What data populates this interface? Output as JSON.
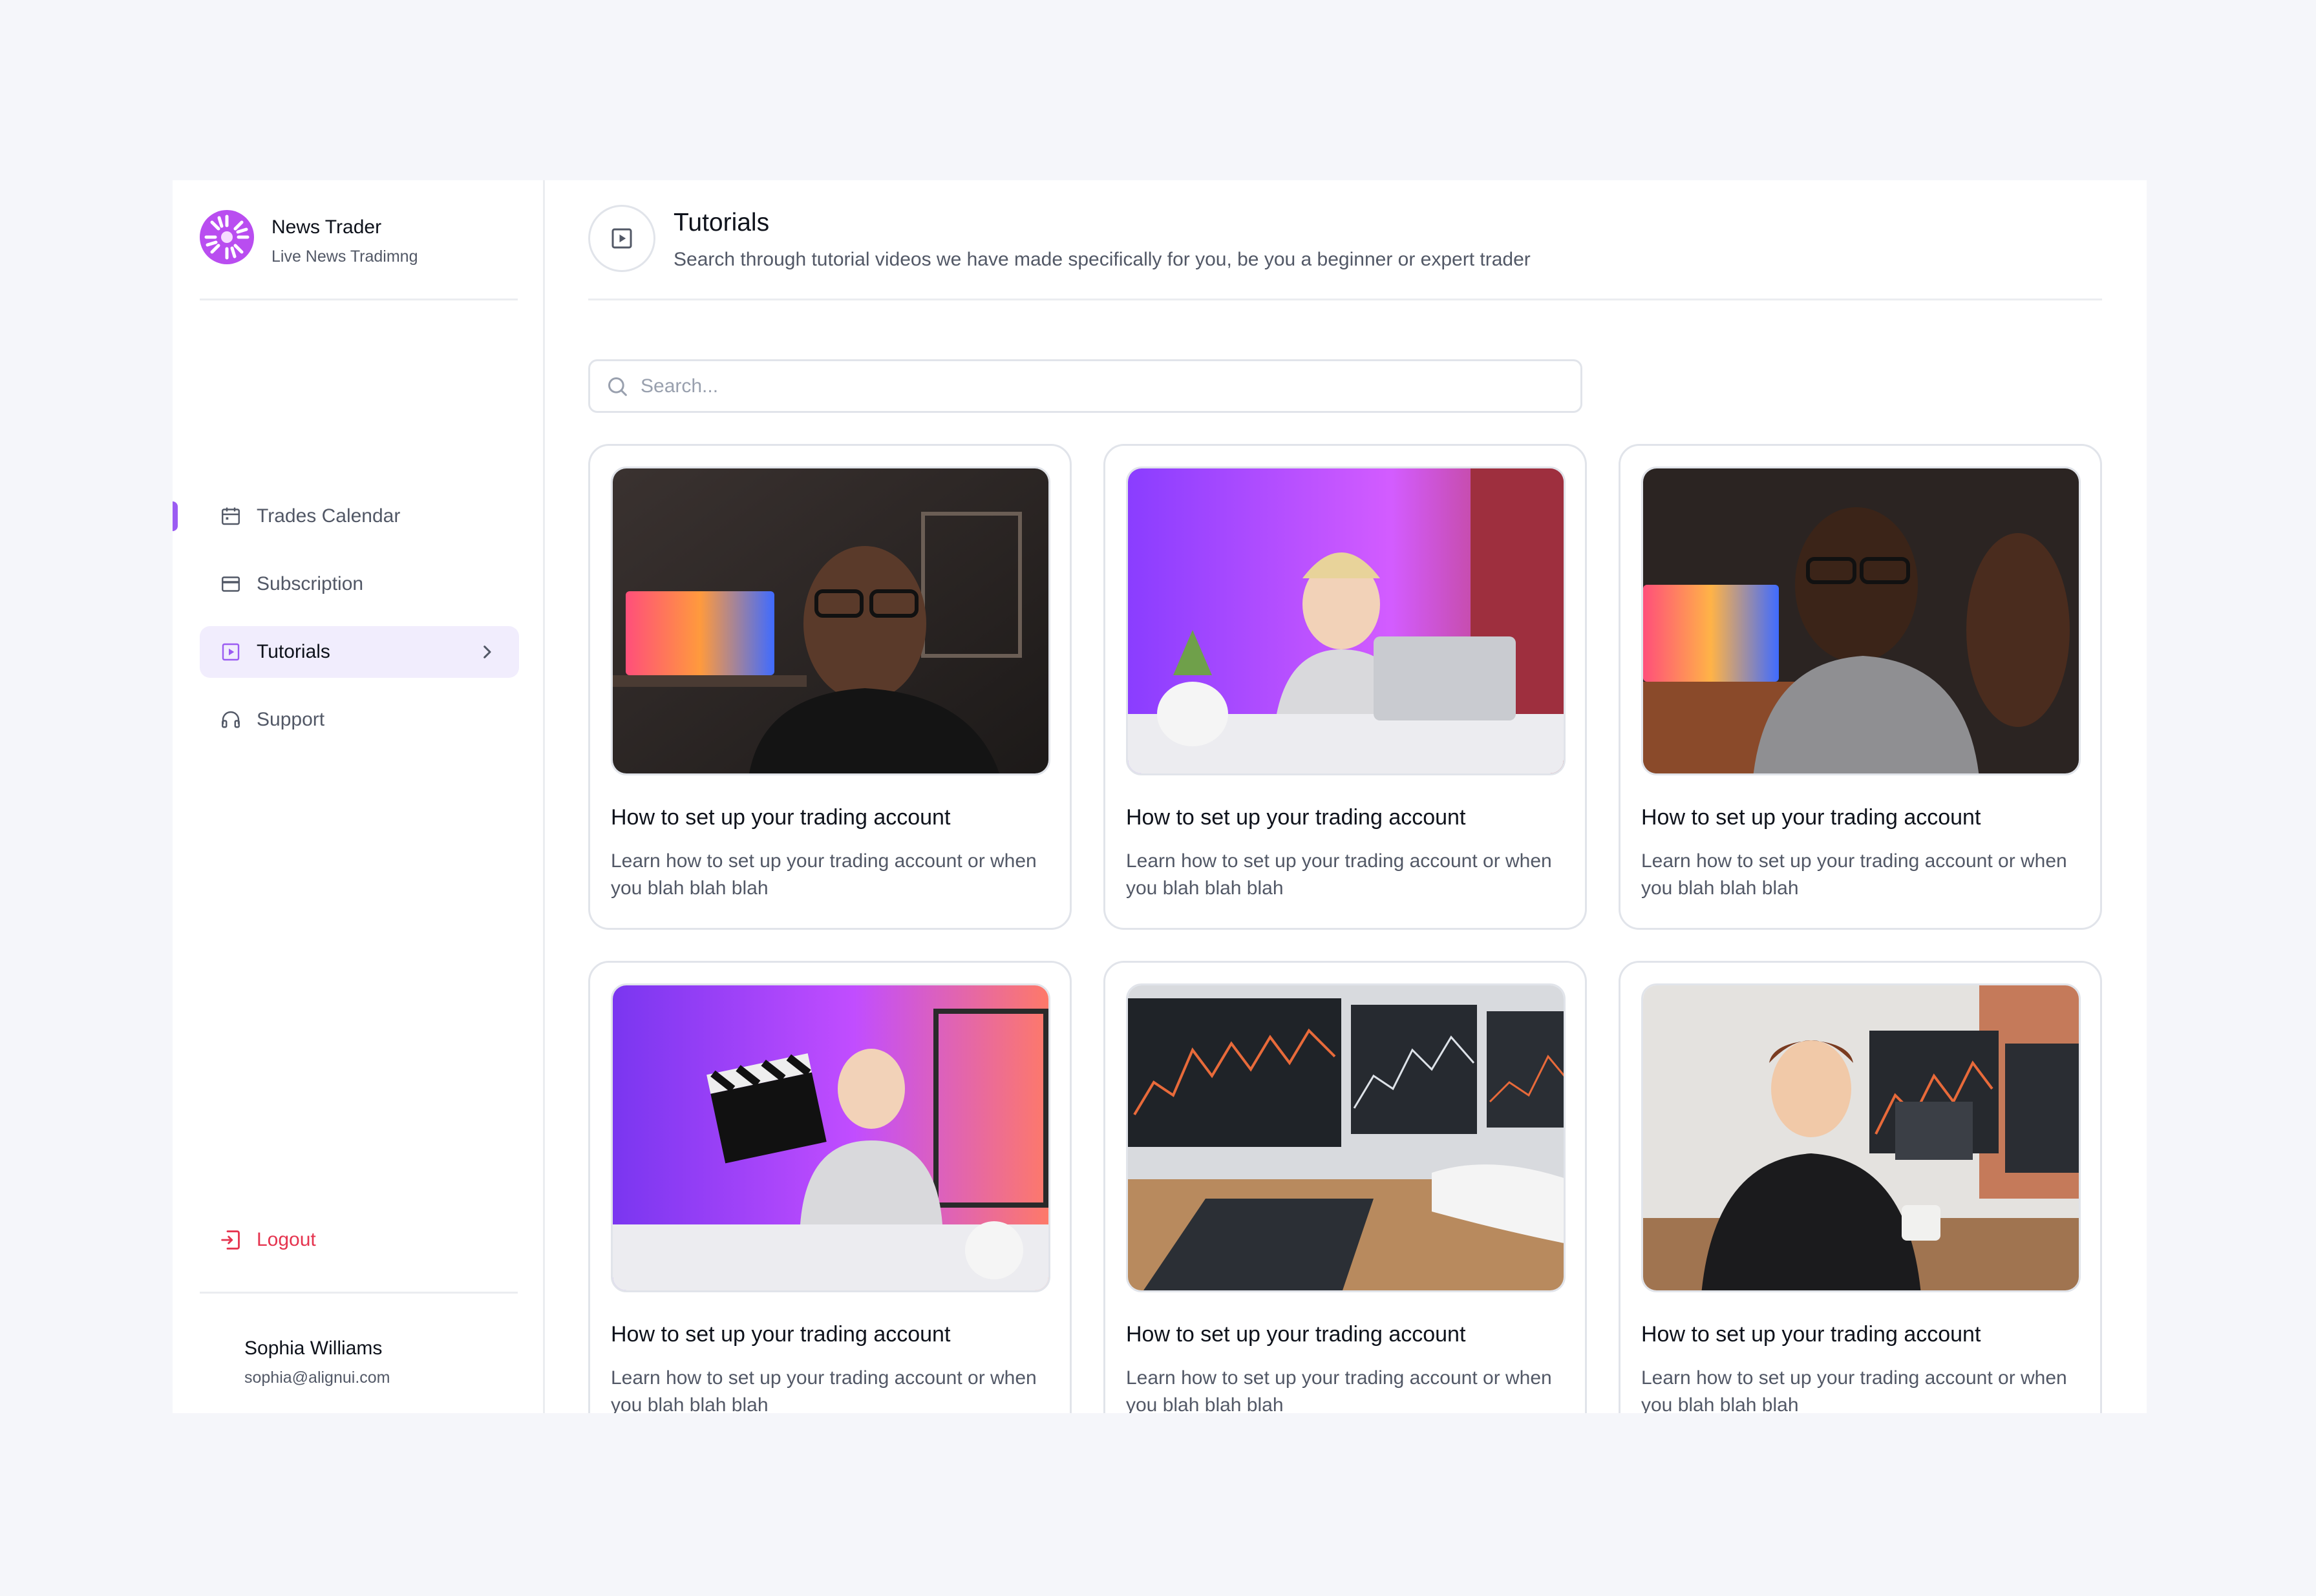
{
  "brand": {
    "name": "News Trader",
    "subtitle": "Live News Tradimng"
  },
  "nav": {
    "items": [
      {
        "label": "Trades Calendar",
        "icon": "calendar-icon",
        "active": false
      },
      {
        "label": "Subscription",
        "icon": "credit-card-icon",
        "active": false
      },
      {
        "label": "Tutorials",
        "icon": "play-square-icon",
        "active": true
      },
      {
        "label": "Support",
        "icon": "headphones-icon",
        "active": false
      }
    ],
    "logout_label": "Logout"
  },
  "user": {
    "name": "Sophia Williams",
    "email": "sophia@alignui.com"
  },
  "header": {
    "title": "Tutorials",
    "description": "Search through tutorial videos we have made specifically for you, be you a beginner or expert trader"
  },
  "search": {
    "placeholder": "Search...",
    "value": ""
  },
  "cards": [
    {
      "title": "How to set up your trading account",
      "description": "Learn how to set up your trading account or when you blah blah blah"
    },
    {
      "title": "How to set up your trading account",
      "description": "Learn how to set up your trading account or when you blah blah blah"
    },
    {
      "title": "How to set up your trading account",
      "description": "Learn how to set up your trading account or when you blah blah blah"
    },
    {
      "title": "How to set up your trading account",
      "description": "Learn how to set up your trading account or when you blah blah blah"
    },
    {
      "title": "How to set up your trading account",
      "description": "Learn how to set up your trading account or when you blah blah blah"
    },
    {
      "title": "How to set up your trading account",
      "description": "Learn how to set up your trading account or when you blah blah blah"
    }
  ],
  "colors": {
    "accent": "#9b5cf2",
    "active_bg": "#f1edfd",
    "danger": "#e5344f",
    "text_primary": "#0e121b",
    "text_secondary": "#525866",
    "border": "#e1e4ea",
    "page_bg": "#f5f6fa"
  }
}
